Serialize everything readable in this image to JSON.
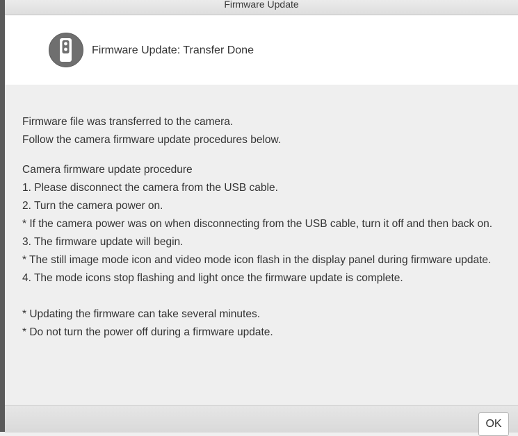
{
  "window": {
    "title": "Firmware Update"
  },
  "header": {
    "icon": "camera-icon",
    "text": "Firmware Update: Transfer Done"
  },
  "message": {
    "intro": [
      "Firmware file was transferred to the camera.",
      "Follow the camera firmware update procedures below."
    ],
    "procedure": [
      "Camera firmware update procedure",
      "1. Please disconnect the camera from the USB cable.",
      "2. Turn the camera power on.",
      "* If the camera power was on when disconnecting from the USB cable, turn it off and then back on.",
      "3. The firmware update will begin.",
      "* The still image mode icon and video mode icon flash in the display panel during firmware update.",
      "4. The mode icons stop flashing and light once the firmware update is complete."
    ],
    "notes": [
      "* Updating the firmware can take several minutes.",
      "* Do not turn the power off during a firmware update."
    ]
  },
  "footer": {
    "ok_label": "OK"
  },
  "colors": {
    "icon_background": "#6f6f6f",
    "dialog_background": "#efefef",
    "header_background": "#ffffff"
  }
}
